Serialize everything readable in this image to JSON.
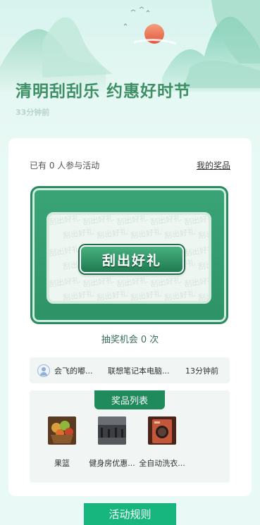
{
  "header": {
    "title": "清明刮刮乐 约惠好时节",
    "countdown": "33分钟前"
  },
  "activity": {
    "participants_text": "已有 0 人参与活动",
    "my_prize_link": "我的奖品",
    "scratch_button": "刮出好礼",
    "pattern_text": "刮出好礼",
    "chances_text": "抽奖机会 0 次"
  },
  "winner": {
    "avatar_icon": "user-avatar-icon",
    "name": "会飞的嘟...",
    "prize": "联想笔记本电脑...",
    "time": "13分钟前"
  },
  "prize_list": {
    "title": "奖品列表",
    "items": [
      {
        "name": "果篮",
        "icon": "fruit-basket-image"
      },
      {
        "name": "健身房优惠...",
        "icon": "gym-image"
      },
      {
        "name": "全自动洗衣...",
        "icon": "washing-machine-image"
      }
    ]
  },
  "footer": {
    "rules_button": "活动规则"
  },
  "colors": {
    "brand_green": "#1f8a5c",
    "title_green": "#3e8f66",
    "rules_button": "#17b67f"
  }
}
